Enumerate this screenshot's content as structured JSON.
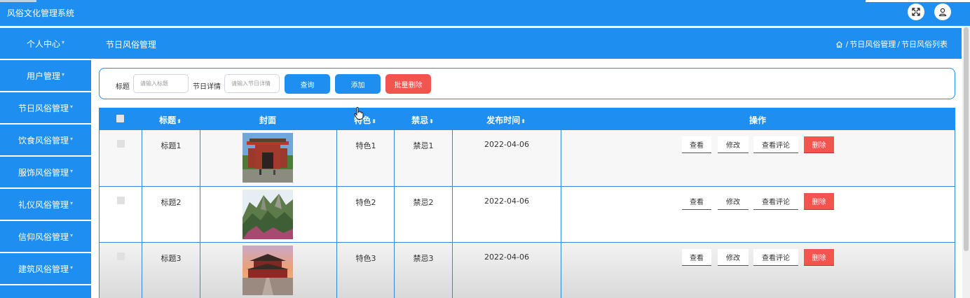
{
  "app": {
    "title": "风俗文化管理系统"
  },
  "icons": {
    "fullscreen": "fullscreen-icon",
    "user": "user-icon",
    "home": "home-icon"
  },
  "colors": {
    "primary": "#1e8ef0",
    "danger": "#f4544e",
    "border": "#2c8ae0"
  },
  "sidebar": {
    "items": [
      {
        "label": "个人中心"
      },
      {
        "label": "用户管理"
      },
      {
        "label": "节日风俗管理"
      },
      {
        "label": "饮食风俗管理"
      },
      {
        "label": "服饰风俗管理"
      },
      {
        "label": "礼仪风俗管理"
      },
      {
        "label": "信仰风俗管理"
      },
      {
        "label": "建筑风俗管理"
      }
    ]
  },
  "header": {
    "page_title": "节日风俗管理",
    "breadcrumb": [
      "节日风俗管理",
      "节日风俗列表"
    ],
    "separator": "/"
  },
  "search": {
    "title_label": "标题",
    "title_placeholder": "请输入标题",
    "detail_label": "节日详情",
    "detail_placeholder": "请输入节日详情",
    "query_label": "查询",
    "add_label": "添加",
    "batch_delete_label": "批量删除"
  },
  "table": {
    "columns": [
      "标题",
      "封面",
      "特色",
      "禁忌",
      "发布时间",
      "操作"
    ],
    "sort_mark": "⬍",
    "rows": [
      {
        "title": "标题1",
        "feature": "特色1",
        "taboo": "禁忌1",
        "date": "2022-04-06",
        "cover": "gate"
      },
      {
        "title": "标题2",
        "feature": "特色2",
        "taboo": "禁忌2",
        "date": "2022-04-06",
        "cover": "mountain"
      },
      {
        "title": "标题3",
        "feature": "特色3",
        "taboo": "禁忌3",
        "date": "2022-04-06",
        "cover": "palace"
      }
    ],
    "actions": {
      "view": "查看",
      "edit": "修改",
      "view_comments": "查看评论",
      "delete": "删除"
    }
  }
}
